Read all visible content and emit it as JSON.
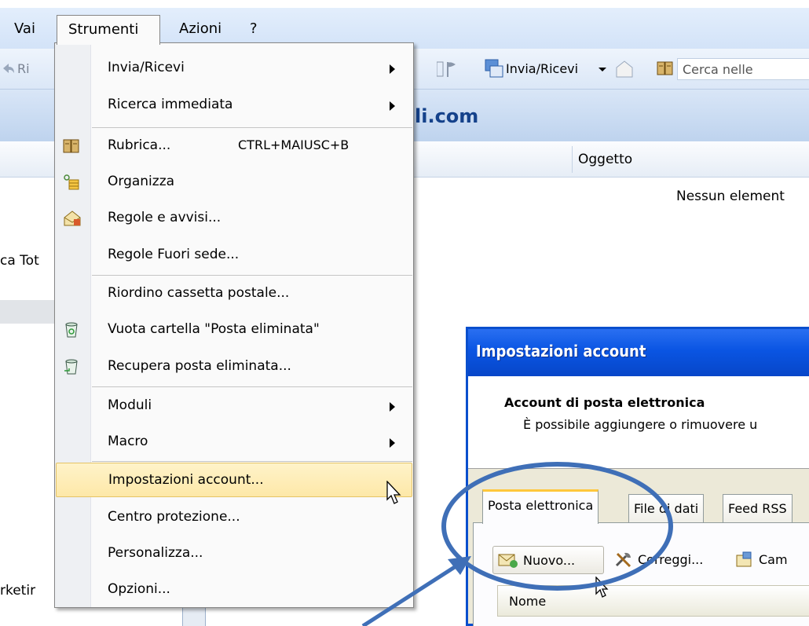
{
  "menubar": {
    "items": [
      "Vai",
      "Strumenti",
      "Azioni",
      "?"
    ]
  },
  "toolbar": {
    "reply_fragment": "Ri",
    "send_receive": "Invia/Ricevi",
    "search_placeholder": "Cerca nelle"
  },
  "header": {
    "account_fragment": "li.com"
  },
  "columns": {
    "subject": "Oggetto",
    "empty_message": "Nessun element"
  },
  "left_pane": {
    "fragment1": "ca Tot",
    "fragment2": "rketir"
  },
  "menu": {
    "items": [
      {
        "label": "Invia/Ricevi",
        "submenu": true
      },
      {
        "label": "Ricerca immediata",
        "submenu": true
      },
      {
        "label": "Rubrica...",
        "shortcut": "CTRL+MAIUSC+B",
        "icon": "address-book-icon"
      },
      {
        "label": "Organizza",
        "icon": "organize-icon"
      },
      {
        "label": "Regole e avvisi...",
        "icon": "rules-icon"
      },
      {
        "label": "Regole Fuori sede..."
      },
      {
        "label": "Riordino cassetta postale..."
      },
      {
        "label": "Vuota cartella \"Posta eliminata\"",
        "icon": "empty-trash-icon"
      },
      {
        "label": "Recupera posta eliminata...",
        "icon": "recover-trash-icon"
      },
      {
        "label": "Moduli",
        "submenu": true
      },
      {
        "label": "Macro",
        "submenu": true
      },
      {
        "label": "Impostazioni account...",
        "highlighted": true
      },
      {
        "label": "Centro protezione..."
      },
      {
        "label": "Personalizza..."
      },
      {
        "label": "Opzioni..."
      }
    ]
  },
  "dialog": {
    "title": "Impostazioni account",
    "heading": "Account di posta elettronica",
    "description": "È possibile aggiungere o rimuovere u",
    "tabs": [
      "Posta elettronica",
      "File di dati",
      "Feed RSS"
    ],
    "buttons": {
      "new": "Nuovo...",
      "repair": "Correggi...",
      "change": "Cam"
    },
    "list_header": "Nome"
  },
  "colors": {
    "highlight": "#fde8a8",
    "dialog_title": "#0a55e3",
    "annotation": "#3f6fb7"
  }
}
